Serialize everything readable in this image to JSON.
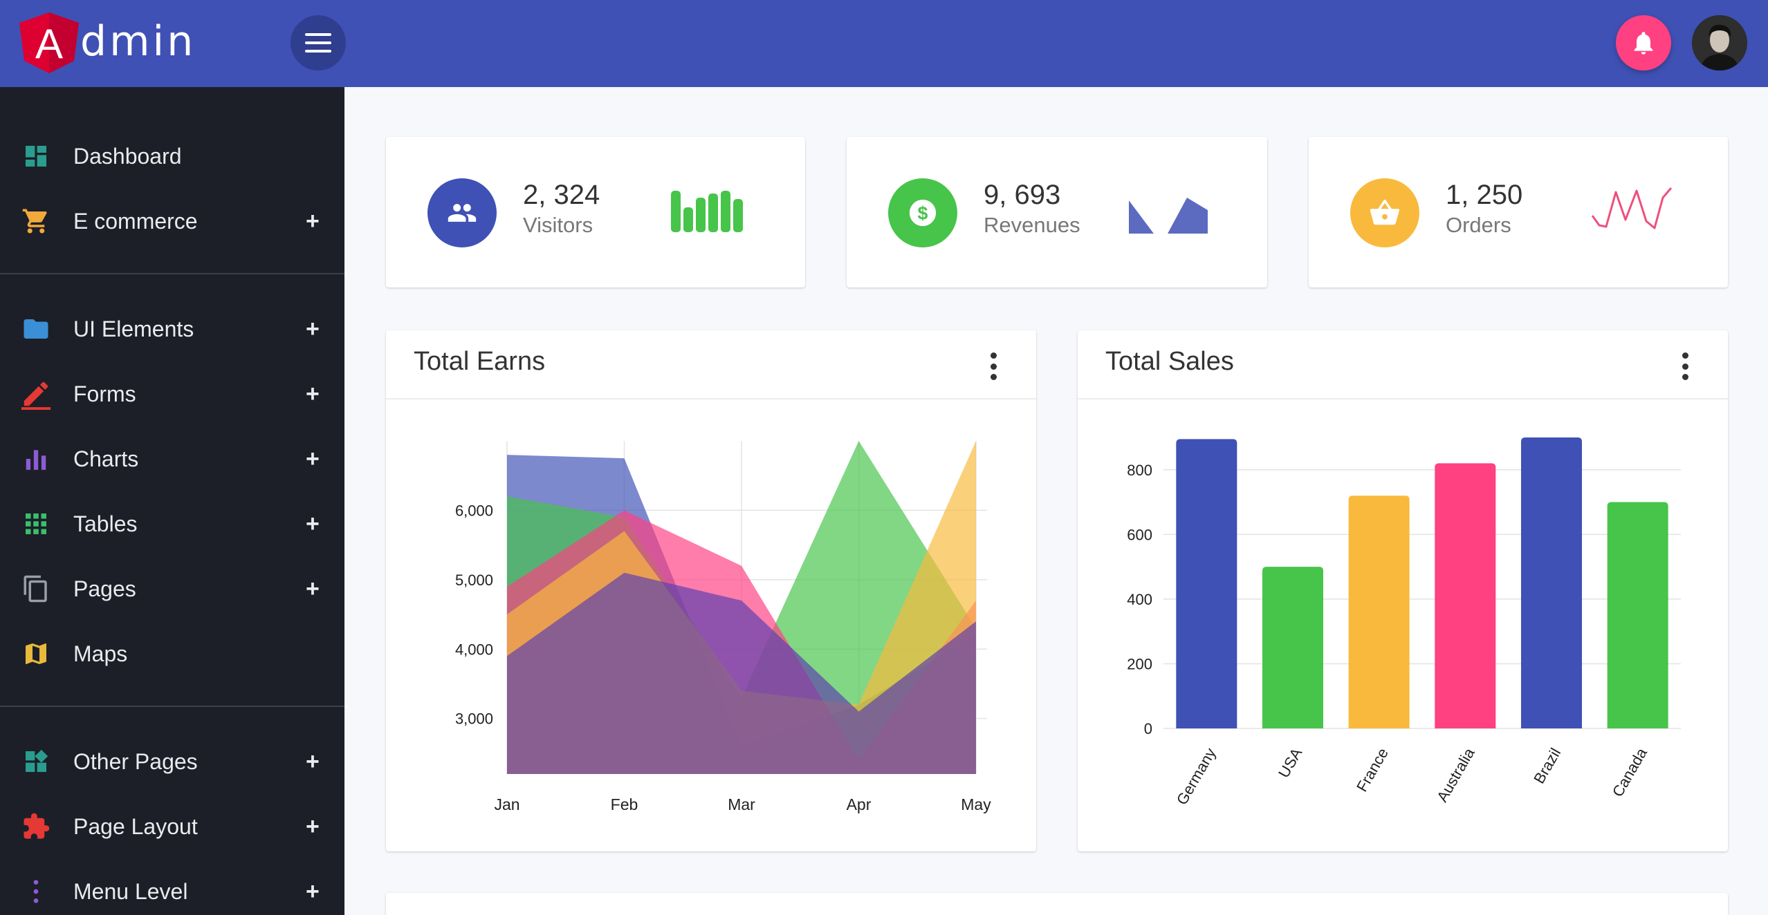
{
  "app": {
    "logo_letter": "A",
    "logo_rest": "dmin"
  },
  "sidebar": {
    "items": [
      {
        "label": "Dashboard",
        "icon": "dashboard-icon",
        "expandable": false,
        "color": "#2a9d8f"
      },
      {
        "label": "E commerce",
        "icon": "cart-icon",
        "expandable": true,
        "color": "#f2a93b"
      },
      {
        "label": "UI Elements",
        "icon": "folder-icon",
        "expandable": true,
        "color": "#3a8fd6"
      },
      {
        "label": "Forms",
        "icon": "pencil-icon",
        "expandable": true,
        "color": "#e53935"
      },
      {
        "label": "Charts",
        "icon": "bar-chart-icon",
        "expandable": true,
        "color": "#8e5bd6"
      },
      {
        "label": "Tables",
        "icon": "grid-icon",
        "expandable": true,
        "color": "#3bbf6b"
      },
      {
        "label": "Pages",
        "icon": "pages-icon",
        "expandable": true,
        "color": "#9a9ea8"
      },
      {
        "label": "Maps",
        "icon": "map-icon",
        "expandable": false,
        "color": "#e8b93a"
      },
      {
        "label": "Other Pages",
        "icon": "widgets-icon",
        "expandable": true,
        "color": "#2a9d8f"
      },
      {
        "label": "Page Layout",
        "icon": "puzzle-icon",
        "expandable": true,
        "color": "#e53935"
      },
      {
        "label": "Menu Level",
        "icon": "more-vert-icon",
        "expandable": true,
        "color": "#8e5bd6"
      }
    ],
    "plus_glyph": "+"
  },
  "stats": [
    {
      "value": "2, 324",
      "label": "Visitors",
      "icon": "people-icon",
      "color": "#3f51b5",
      "spark_color": "#47c44a"
    },
    {
      "value": "9, 693",
      "label": "Revenues",
      "icon": "dollar-icon",
      "color": "#47c44a",
      "spark_color": "#5c6bc0"
    },
    {
      "value": "1, 250",
      "label": "Orders",
      "icon": "basket-icon",
      "color": "#f9b93d",
      "spark_color": "#ef4f7c"
    }
  ],
  "panels": {
    "earns_title": "Total Earns",
    "sales_title": "Total Sales"
  },
  "chart_data": [
    {
      "type": "area",
      "title": "Total Earns",
      "categories": [
        "Jan",
        "Feb",
        "Mar",
        "Apr",
        "May"
      ],
      "yticks": [
        3000,
        4000,
        5000,
        6000
      ],
      "ytick_labels": [
        "3,000",
        "4,000",
        "5,000",
        "6,000"
      ],
      "ylim": [
        2200,
        7000
      ],
      "grid": true,
      "series": [
        {
          "color": "#3f51b5",
          "values": [
            6800,
            6750,
            2600,
            3200,
            4200
          ]
        },
        {
          "color": "#47c44a",
          "values": [
            6200,
            5900,
            3300,
            7000,
            4300
          ]
        },
        {
          "color": "#ff4081",
          "values": [
            4900,
            6000,
            5200,
            2400,
            4700
          ]
        },
        {
          "color": "#f9b93d",
          "values": [
            4500,
            5700,
            3400,
            3200,
            7000
          ]
        },
        {
          "color": "#5b3fae",
          "values": [
            3900,
            5100,
            4700,
            3100,
            4400
          ]
        }
      ]
    },
    {
      "type": "bar",
      "title": "Total Sales",
      "categories": [
        "Germany",
        "USA",
        "France",
        "Australia",
        "Brazil",
        "Canada"
      ],
      "values": [
        895,
        500,
        720,
        820,
        900,
        700
      ],
      "colors": [
        "#3f51b5",
        "#47c44a",
        "#f9b93d",
        "#ff4081",
        "#3f51b5",
        "#47c44a"
      ],
      "yticks": [
        0,
        200,
        400,
        600,
        800
      ],
      "ylim": [
        0,
        900
      ],
      "grid": true
    }
  ]
}
